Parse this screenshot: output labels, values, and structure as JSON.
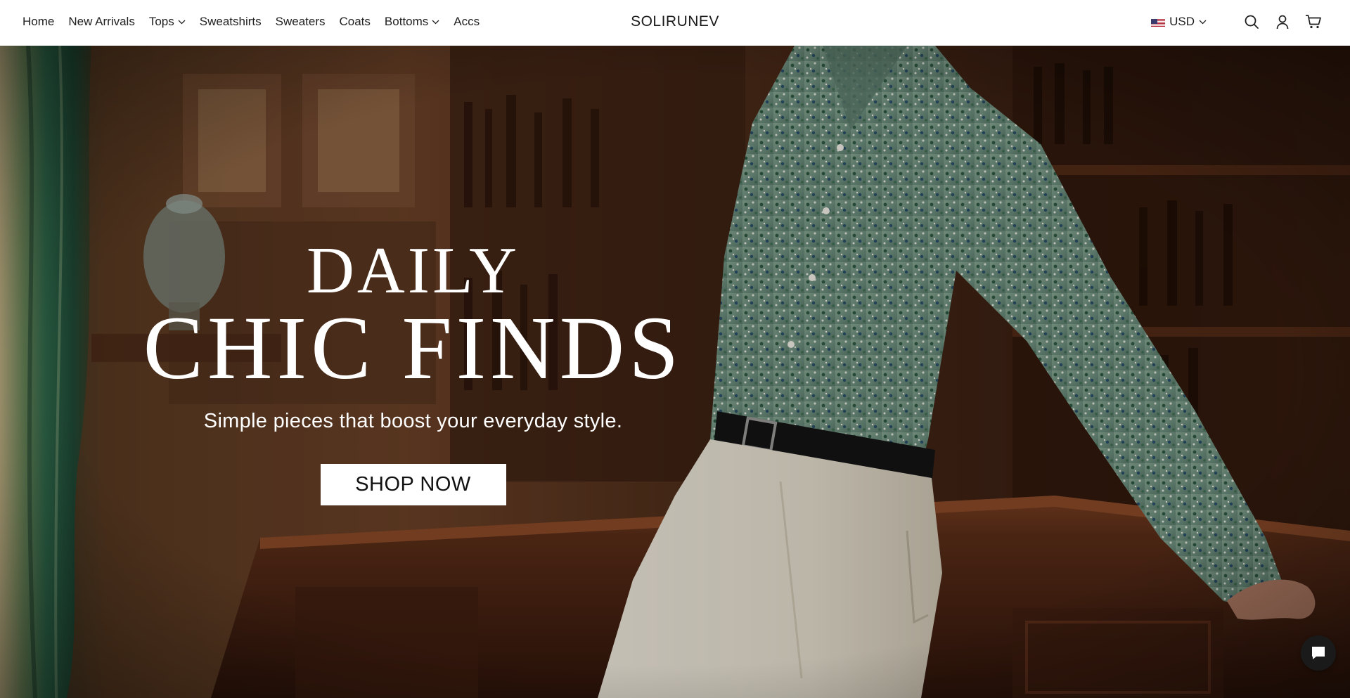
{
  "nav": {
    "items": [
      {
        "label": "Home",
        "has_dropdown": false
      },
      {
        "label": "New Arrivals",
        "has_dropdown": false
      },
      {
        "label": "Tops",
        "has_dropdown": true
      },
      {
        "label": "Sweatshirts",
        "has_dropdown": false
      },
      {
        "label": "Sweaters",
        "has_dropdown": false
      },
      {
        "label": "Coats",
        "has_dropdown": false
      },
      {
        "label": "Bottoms",
        "has_dropdown": true
      },
      {
        "label": "Accs",
        "has_dropdown": false
      }
    ]
  },
  "brand": {
    "name": "SOLIRUNEV"
  },
  "tools": {
    "currency": "USD",
    "flag_icon": "us-flag-icon",
    "icons": [
      "search-icon",
      "account-icon",
      "cart-icon"
    ]
  },
  "hero": {
    "title_line1": "DAILY",
    "title_line2": "CHIC FINDS",
    "subtitle": "Simple pieces that boost your everyday style.",
    "cta_label": "SHOP NOW"
  },
  "chat": {
    "icon": "chat-bubble-icon"
  },
  "colors": {
    "header_bg": "#ffffff",
    "text": "#1f1f1f",
    "hero_text": "#ffffff",
    "cta_bg": "#ffffff",
    "chat_bg": "#1a1a1a"
  }
}
